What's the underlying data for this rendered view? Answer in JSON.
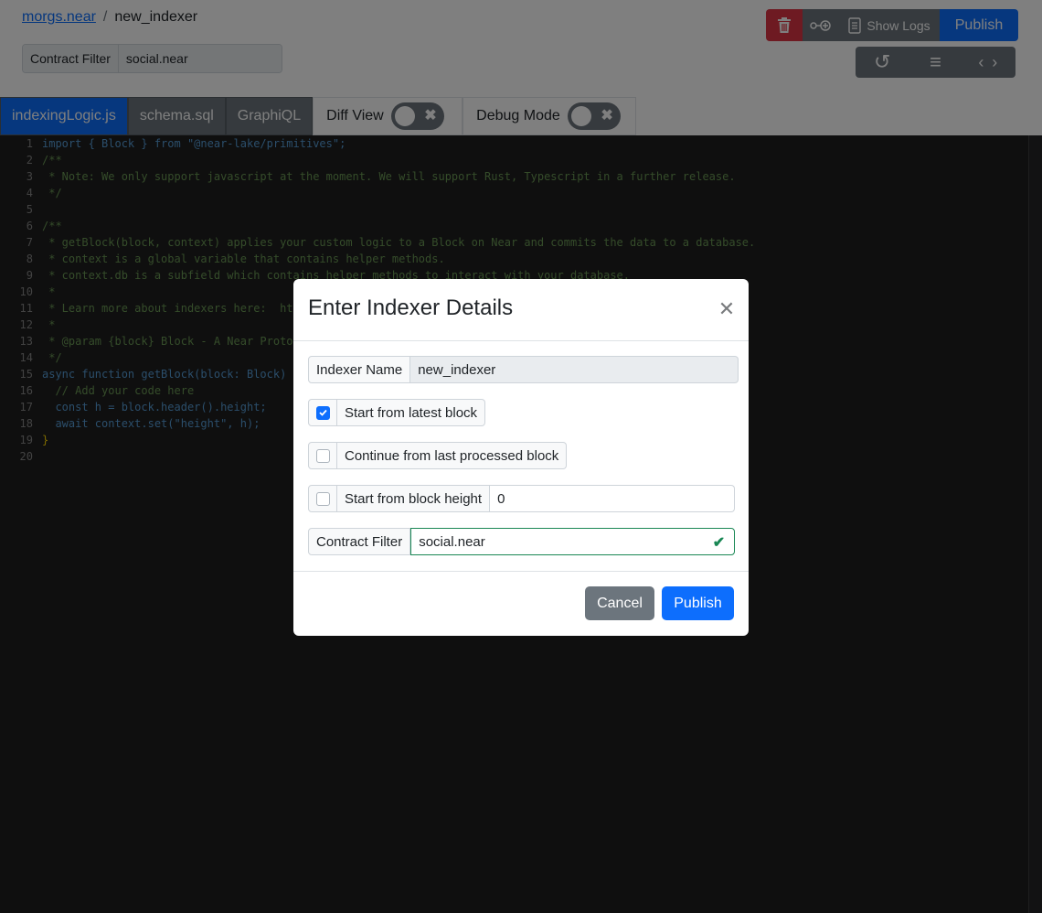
{
  "breadcrumb": {
    "account": "morgs.near",
    "separator": "/",
    "indexer": "new_indexer"
  },
  "top_filter": {
    "label": "Contract Filter",
    "value": "social.near"
  },
  "actions": {
    "delete_icon": "trash-icon",
    "settings_icon": "fork-icon",
    "logs_label": "Show Logs",
    "publish_label": "Publish"
  },
  "secondary_actions": {
    "reset_icon": "undo-icon",
    "format_icon": "lines-icon",
    "code_icon": "code-icon",
    "reset_glyph": "↺",
    "format_glyph": "≡",
    "code_glyph": "‹ ›"
  },
  "tabs": [
    {
      "label": "indexingLogic.js",
      "active": true
    },
    {
      "label": "schema.sql",
      "active": false
    },
    {
      "label": "GraphiQL",
      "active": false
    }
  ],
  "toggles": {
    "diff_label": "Diff View",
    "debug_label": "Debug Mode",
    "off_glyph": "✖"
  },
  "editor": {
    "line_numbers": [
      "1",
      "2",
      "3",
      "4",
      "5",
      "6",
      "7",
      "8",
      "9",
      "10",
      "11",
      "12",
      "13",
      "14",
      "15",
      "16",
      "17",
      "18",
      "19",
      "20"
    ],
    "lines": [
      "import { Block } from \"@near-lake/primitives\";",
      "/**",
      " * Note: We only support javascript at the moment. We will support Rust, Typescript in a further release.",
      " */",
      "",
      "/**",
      " * getBlock(block, context) applies your custom logic to a Block on Near and commits the data to a database.",
      " * context is a global variable that contains helper methods.",
      " * context.db is a subfield which contains helper methods to interact with your database.",
      " *",
      " * Learn more about indexers here:  ht",
      " *",
      " * @param {block} Block - A Near Proto",
      " */",
      "async function getBlock(block: Block)",
      "  // Add your code here",
      "  const h = block.header().height;",
      "  await context.set(\"height\", h);",
      "}",
      ""
    ]
  },
  "modal": {
    "title": "Enter Indexer Details",
    "close_glyph": "✕",
    "indexer_name_label": "Indexer Name",
    "indexer_name_value": "new_indexer",
    "opt_latest": "Start from latest block",
    "opt_continue": "Continue from last processed block",
    "opt_height": "Start from block height",
    "height_value": "0",
    "contract_filter_label": "Contract Filter",
    "contract_filter_value": "social.near",
    "valid_glyph": "✔",
    "cancel_label": "Cancel",
    "publish_label": "Publish"
  },
  "colors": {
    "primary": "#0d6efd",
    "danger": "#dc3545",
    "secondary": "#6c757d",
    "success": "#198754",
    "editor_bg": "#1e1e1e"
  }
}
